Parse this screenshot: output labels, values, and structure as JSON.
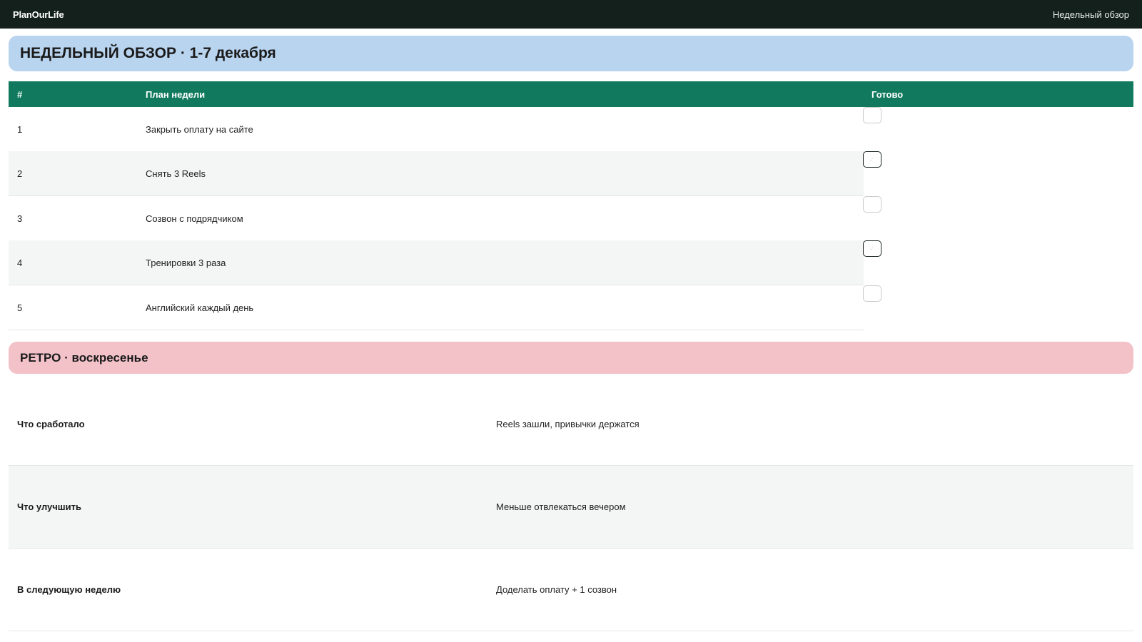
{
  "app": {
    "brand": "PlanOurLife",
    "nav_link": "Недельный обзор"
  },
  "week": {
    "title": "НЕДЕЛЬНЫЙ ОБЗОР · 1-7 декабря"
  },
  "plan": {
    "columns": [
      "#",
      "План недели",
      "Готово"
    ],
    "rows": [
      {
        "num": "1",
        "task": "Закрыть оплату на сайте",
        "done": false
      },
      {
        "num": "2",
        "task": "Снять 3 Reels",
        "done": true
      },
      {
        "num": "3",
        "task": "Созвон с подрядчиком",
        "done": false
      },
      {
        "num": "4",
        "task": "Тренировки 3 раза",
        "done": true
      },
      {
        "num": "5",
        "task": "Английский каждый день",
        "done": false
      }
    ]
  },
  "retro": {
    "title": "РЕТРО · воскресенье",
    "rows": [
      {
        "question": "Что сработало",
        "answer": "Reels зашли, привычки держатся"
      },
      {
        "question": "Что улучшить",
        "answer": "Меньше отвлекаться вечером"
      },
      {
        "question": "В следующую неделю",
        "answer": "Доделать оплату + 1 созвон"
      }
    ]
  },
  "colors": {
    "topbar": "#13201c",
    "week_banner": "#b9d4ef",
    "plan_header": "#117a5e",
    "retro_banner": "#f3c2c9",
    "row_alt": "#f3f6f5"
  }
}
